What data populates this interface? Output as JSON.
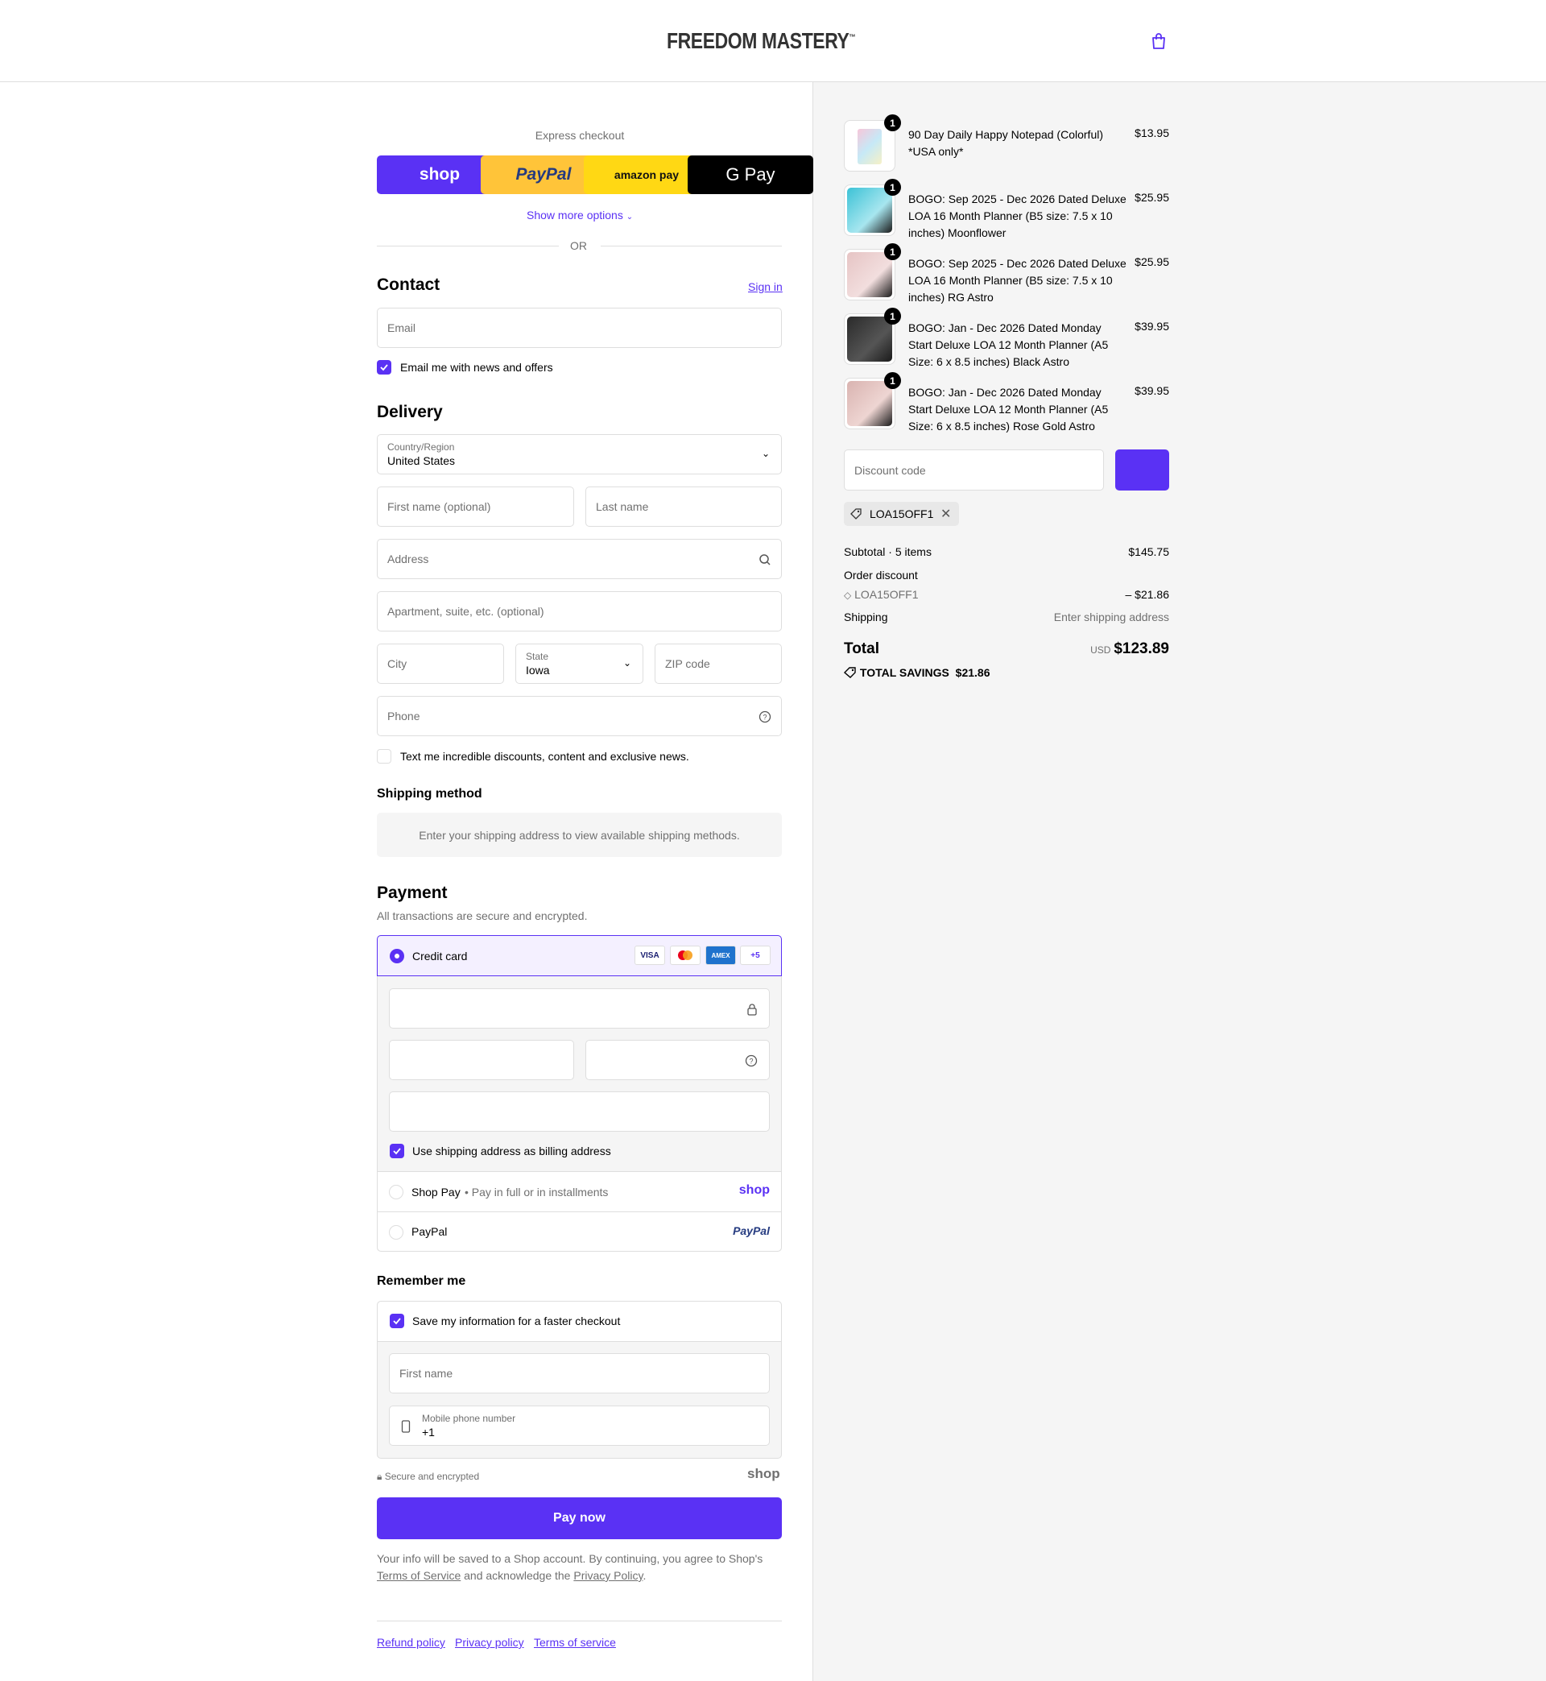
{
  "brand": {
    "name": "FREEDOM MASTERY",
    "tm": "™"
  },
  "express": {
    "title": "Express checkout",
    "buttons": [
      "shop",
      "PayPal",
      "amazon pay",
      "G Pay"
    ],
    "show_more": "Show more options",
    "or": "OR"
  },
  "contact": {
    "title": "Contact",
    "sign_in": "Sign in",
    "email_placeholder": "Email",
    "news_label": "Email me with news and offers"
  },
  "delivery": {
    "title": "Delivery",
    "country_label": "Country/Region",
    "country_value": "United States",
    "first_name_ph": "First name (optional)",
    "last_name_ph": "Last name",
    "address_ph": "Address",
    "apt_ph": "Apartment, suite, etc. (optional)",
    "city_ph": "City",
    "state_label": "State",
    "state_value": "Iowa",
    "zip_ph": "ZIP code",
    "phone_ph": "Phone",
    "sms_label": "Text me incredible discounts, content and exclusive news."
  },
  "shipping_method": {
    "title": "Shipping method",
    "notice": "Enter your shipping address to view available shipping methods."
  },
  "payment": {
    "title": "Payment",
    "subtitle": "All transactions are secure and encrypted.",
    "credit_card": "Credit card",
    "cards": [
      "VISA",
      "MC",
      "AMEX",
      "+5"
    ],
    "billing_label": "Use shipping address as billing address",
    "shop_pay": "Shop Pay",
    "shop_pay_sub": "Pay in full or in installments",
    "shop_pay_logo": "shop",
    "paypal": "PayPal",
    "paypal_logo": "PayPal"
  },
  "remember": {
    "title": "Remember me",
    "save_label": "Save my information for a faster checkout",
    "first_name_ph": "First name",
    "phone_label": "Mobile phone number",
    "phone_value": "+1",
    "secure": "Secure and encrypted",
    "shop_logo": "shop"
  },
  "pay_now": "Pay now",
  "legal": {
    "line1": "Your info will be saved to a Shop account. By continuing, you agree to Shop's",
    "tos": "Terms of Service",
    "and": " and acknowledge the ",
    "privacy": "Privacy Policy",
    "end": "."
  },
  "footer_links": [
    "Refund policy",
    "Privacy policy",
    "Terms of service"
  ],
  "cart": {
    "items": [
      {
        "qty": "1",
        "name": "90 Day Daily Happy Notepad (Colorful) *USA only*",
        "price": "$13.95",
        "color": "#eaf6f6"
      },
      {
        "qty": "1",
        "name": "BOGO: Sep 2025 - Dec 2026 Dated Deluxe LOA 16 Month Planner (B5 size: 7.5 x 10 inches) Moonflower",
        "price": "$25.95",
        "color": "#3cc2d6"
      },
      {
        "qty": "1",
        "name": "BOGO: Sep 2025 - Dec 2026 Dated Deluxe LOA 16 Month Planner (B5 size: 7.5 x 10 inches) RG Astro",
        "price": "$25.95",
        "color": "#e6c4c4"
      },
      {
        "qty": "1",
        "name": "BOGO: Jan - Dec 2026 Dated Monday Start Deluxe LOA 12 Month Planner (A5 Size: 6 x 8.5 inches) Black Astro",
        "price": "$39.95",
        "color": "#2a2a2a"
      },
      {
        "qty": "1",
        "name": "BOGO: Jan - Dec 2026 Dated Monday Start Deluxe LOA 12 Month Planner (A5 Size: 6 x 8.5 inches) Rose Gold Astro",
        "price": "$39.95",
        "color": "#d9b3b0"
      }
    ],
    "discount_ph": "Discount code",
    "code_tag": "LOA15OFF1",
    "subtotal_label": "Subtotal · 5 items",
    "subtotal": "$145.75",
    "order_discount_label": "Order discount",
    "discount_code": "LOA15OFF1",
    "discount_amount": "– $21.86",
    "shipping_label": "Shipping",
    "shipping_value": "Enter shipping address",
    "total_label": "Total",
    "currency": "USD",
    "total": "$123.89",
    "savings_label": "TOTAL SAVINGS",
    "savings": "$21.86"
  },
  "colors": {
    "accent": "#5a31f4",
    "paypal": "#ffc439",
    "amazon": "#ffd814"
  }
}
